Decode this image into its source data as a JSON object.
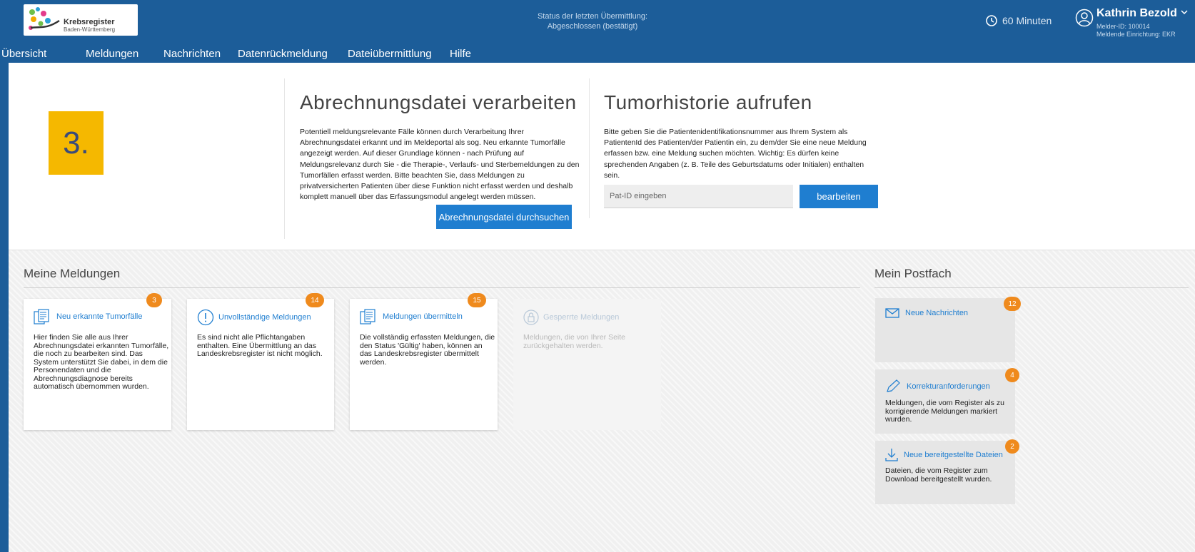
{
  "header": {
    "logo_line1": "Krebsregister",
    "logo_line2": "Baden-Württemberg",
    "status_line1": "Status der letzten Übermittlung:",
    "status_line2": "Abgeschlossen (bestätigt)",
    "timer": "60 Minuten",
    "user_name": "Kathrin Bezold",
    "user_id": "Melder-ID: 100014",
    "user_org": "Meldende Einrichtung: EKR"
  },
  "nav": [
    {
      "label": "Übersicht"
    },
    {
      "label": "Meldungen"
    },
    {
      "label": "Nachrichten"
    },
    {
      "label": "Datenrückmeldung"
    },
    {
      "label": "Dateiübermittlung"
    },
    {
      "label": "Hilfe"
    }
  ],
  "step_marker": "3.",
  "abrechnung": {
    "title": "Abrechnungsdatei verarbeiten",
    "text": "Potentiell meldungsrelevante Fälle können durch Verarbeitung Ihrer Abrechnungsdatei erkannt und im Meldeportal als sog. Neu erkannte Tumorfälle angezeigt werden. Auf dieser Grundlage können - nach Prüfung auf Meldungsrelevanz durch Sie - die Therapie-, Verlaufs- und Sterbemeldungen zu den Tumorfällen erfasst werden. Bitte beachten Sie, dass Meldungen zu privatversicherten Patienten über diese Funktion nicht erfasst werden und deshalb komplett manuell über das Erfassungsmodul angelegt werden müssen.",
    "button": "Abrechnungsdatei durchsuchen"
  },
  "tumorhistorie": {
    "title": "Tumorhistorie aufrufen",
    "text": "Bitte geben Sie die Patientenidentifikationsnummer aus Ihrem System als PatientenId des Patienten/der Patientin ein, zu dem/der Sie eine neue Meldung erfassen bzw. eine Meldung suchen möchten. Wichtig: Es dürfen keine sprechenden Angaben (z. B. Teile des Geburtsdatums oder Initialen) enthalten sein.",
    "placeholder": "Pat-ID eingeben",
    "button": "bearbeiten"
  },
  "meldungen": {
    "title": "Meine Meldungen",
    "cards": [
      {
        "title": "Neu erkannte Tumorfälle",
        "badge": "3",
        "text": "Hier finden Sie alle aus Ihrer Abrechnungsdatei erkannten Tumorfälle, die noch zu bearbeiten sind. Das System unterstützt Sie dabei, in dem die Personendaten und die Abrechnungsdiagnose bereits automatisch übernommen wurden."
      },
      {
        "title": "Unvollständige Meldungen",
        "badge": "14",
        "text": "Es sind nicht alle Pflichtangaben enthalten. Eine Übermittlung an das Landeskrebsregister ist nicht möglich."
      },
      {
        "title": "Meldungen übermitteln",
        "badge": "15",
        "text": "Die vollständig erfassten Meldungen, die den Status 'Gültig' haben, können an das Landeskrebsregister übermittelt werden."
      },
      {
        "title": "Gesperrte Meldungen",
        "text": "Meldungen, die von Ihrer Seite zurückgehalten werden."
      }
    ]
  },
  "postfach": {
    "title": "Mein Postfach",
    "cards": [
      {
        "title": "Neue Nachrichten",
        "badge": "12",
        "text": ""
      },
      {
        "title": "Korrekturanforderungen",
        "badge": "4",
        "text": "Meldungen, die vom Register als zu korrigierende Meldungen markiert wurden."
      },
      {
        "title": "Neue bereitgestellte Dateien",
        "badge": "2",
        "text": "Dateien, die vom Register zum Download bereitgestellt wurden."
      }
    ]
  },
  "colors": {
    "header_bg": "#1c5d99",
    "accent_blue": "#1f7ed0",
    "badge_orange": "#ef8a1d",
    "step_yellow": "#f5b800"
  }
}
